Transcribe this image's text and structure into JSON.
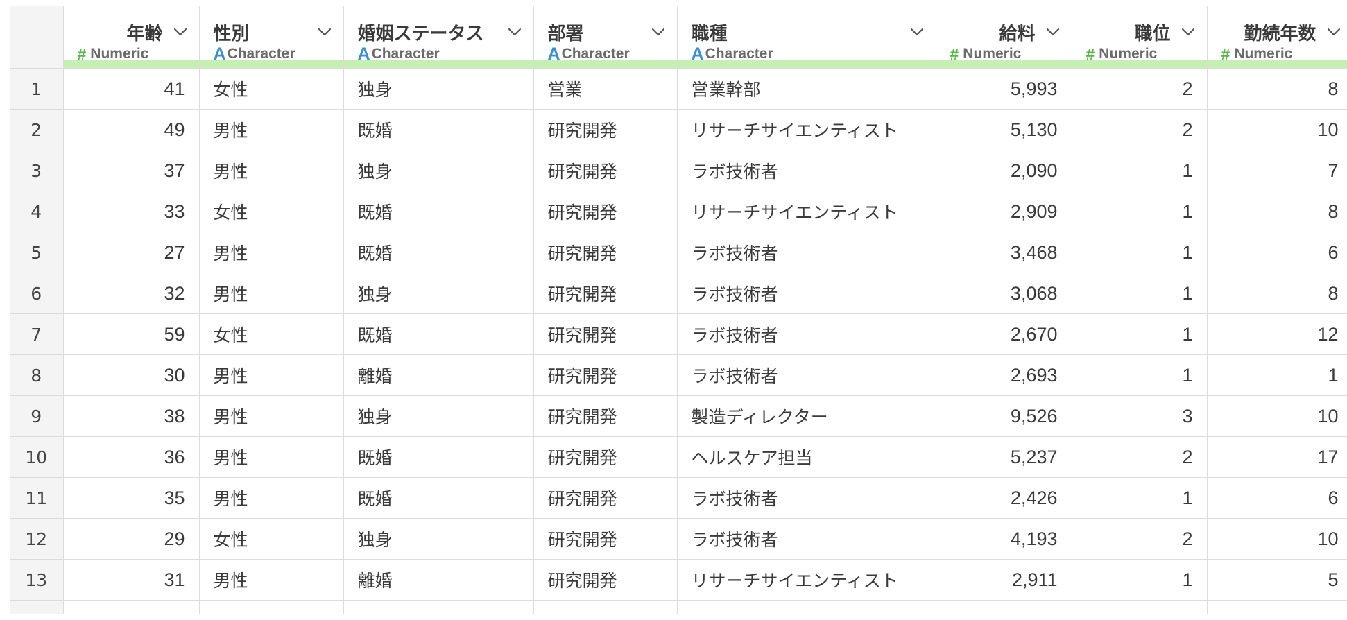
{
  "columns": [
    {
      "name": "年齢",
      "type": "Numeric",
      "kind": "num"
    },
    {
      "name": "性別",
      "type": "Character",
      "kind": "chr"
    },
    {
      "name": "婚姻ステータス",
      "type": "Character",
      "kind": "chr"
    },
    {
      "name": "部署",
      "type": "Character",
      "kind": "chr"
    },
    {
      "name": "職種",
      "type": "Character",
      "kind": "chr"
    },
    {
      "name": "給料",
      "type": "Numeric",
      "kind": "num"
    },
    {
      "name": "職位",
      "type": "Numeric",
      "kind": "num"
    },
    {
      "name": "勤続年数",
      "type": "Numeric",
      "kind": "num"
    }
  ],
  "rows": [
    {
      "n": "1",
      "cells": [
        "41",
        "女性",
        "独身",
        "営業",
        "営業幹部",
        "5,993",
        "2",
        "8"
      ]
    },
    {
      "n": "2",
      "cells": [
        "49",
        "男性",
        "既婚",
        "研究開発",
        "リサーチサイエンティスト",
        "5,130",
        "2",
        "10"
      ]
    },
    {
      "n": "3",
      "cells": [
        "37",
        "男性",
        "独身",
        "研究開発",
        "ラボ技術者",
        "2,090",
        "1",
        "7"
      ]
    },
    {
      "n": "4",
      "cells": [
        "33",
        "女性",
        "既婚",
        "研究開発",
        "リサーチサイエンティスト",
        "2,909",
        "1",
        "8"
      ]
    },
    {
      "n": "5",
      "cells": [
        "27",
        "男性",
        "既婚",
        "研究開発",
        "ラボ技術者",
        "3,468",
        "1",
        "6"
      ]
    },
    {
      "n": "6",
      "cells": [
        "32",
        "男性",
        "独身",
        "研究開発",
        "ラボ技術者",
        "3,068",
        "1",
        "8"
      ]
    },
    {
      "n": "7",
      "cells": [
        "59",
        "女性",
        "既婚",
        "研究開発",
        "ラボ技術者",
        "2,670",
        "1",
        "12"
      ]
    },
    {
      "n": "8",
      "cells": [
        "30",
        "男性",
        "離婚",
        "研究開発",
        "ラボ技術者",
        "2,693",
        "1",
        "1"
      ]
    },
    {
      "n": "9",
      "cells": [
        "38",
        "男性",
        "独身",
        "研究開発",
        "製造ディレクター",
        "9,526",
        "3",
        "10"
      ]
    },
    {
      "n": "10",
      "cells": [
        "36",
        "男性",
        "既婚",
        "研究開発",
        "ヘルスケア担当",
        "5,237",
        "2",
        "17"
      ]
    },
    {
      "n": "11",
      "cells": [
        "35",
        "男性",
        "既婚",
        "研究開発",
        "ラボ技術者",
        "2,426",
        "1",
        "6"
      ]
    },
    {
      "n": "12",
      "cells": [
        "29",
        "女性",
        "独身",
        "研究開発",
        "ラボ技術者",
        "4,193",
        "2",
        "10"
      ]
    },
    {
      "n": "13",
      "cells": [
        "31",
        "男性",
        "離婚",
        "研究開発",
        "リサーチサイエンティスト",
        "2,911",
        "1",
        "5"
      ]
    }
  ],
  "colors": {
    "accent_bar": "#c4f0b4",
    "numeric_icon": "#59b746",
    "character_icon": "#3c8fd4"
  },
  "icons": {
    "numeric": "hash-icon",
    "character": "letter-a-icon",
    "menu": "chevron-down-icon"
  }
}
